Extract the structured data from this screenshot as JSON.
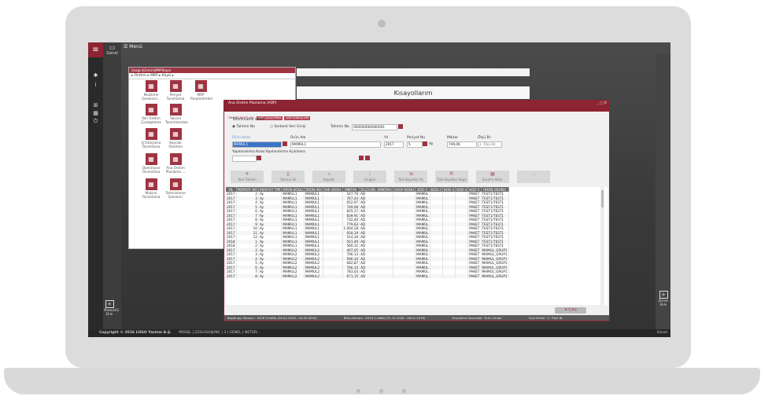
{
  "sidebar": {
    "genel": "Genel",
    "menu": "Menü",
    "masaustu": "Masaüstü Ekle",
    "icons": [
      "home-icon",
      "info-icon",
      "plus-square-icon",
      "apps-icon",
      "power-icon"
    ]
  },
  "shortcuts": {
    "title": "Kısayollarım"
  },
  "rightpanel": {
    "ekle": "Ekranı Ekle"
  },
  "menuwin": {
    "title": "Gezgin|Üretim|MRP\\Kayıt",
    "crumbs": "▸ Üretim  ▸  MRP  ▸  Kayıt  ▸",
    "items": [
      {
        "label": "Malzeme Gereksini...",
        "icon": "tools-icon"
      },
      {
        "label": "Periyot Tanımlama",
        "icon": "calculator-icon"
      },
      {
        "label": "MRP Parametreleri",
        "icon": "doc-gear-icon"
      },
      {
        "label": "İleri Üretim Çizelgeleme",
        "icon": "tools2-icon"
      },
      {
        "label": "Takvim Tanımlamaları",
        "icon": "calendar-icon"
      },
      {
        "label": "İş İstasyonu Tanımlama",
        "icon": "station-icon"
      },
      {
        "label": "Kaynak Yönetimi",
        "icon": "resource-icon"
      },
      {
        "label": "Operasyon Tanımlama",
        "icon": "operation-icon"
      },
      {
        "label": "Ana Üretim Planlama ...",
        "icon": "chart-icon"
      },
      {
        "label": "Makine Tanımlama",
        "icon": "machine-icon"
      },
      {
        "label": "Tahminleme İşlemleri",
        "icon": "trend-icon"
      }
    ]
  },
  "planwin": {
    "title": "Ana Üretim Planlama (AÜP)",
    "controls": "_ □ X",
    "tabs": [
      "TAHMİN KAYITLARI",
      "AÜP ÇALIŞTIRMA",
      "AÜP SONUÇLARI"
    ],
    "tahmin_verisi": "Tahminlama Verisi",
    "radio1": "Tahmin No",
    "radio2": "Serbest Veri Girişi",
    "tahmin_no_label": "Tahmin No",
    "tahmin_no": "000000000000001",
    "urun_kodu_label": "Ürün Kodu",
    "urun_kodu": "MAMUL1",
    "urun_adi_label": "Ürün Adı",
    "urun_adi": "MAMUL1",
    "yil_label": "Yıl",
    "yil": "2017",
    "periyot_label": "Periyot No",
    "periyot": "5",
    "periyot_unit": "Ay",
    "miktar_label": "Miktar",
    "miktar": "749,06",
    "olcu_label": "Ölçü Br.",
    "olcu": "2. Ölçü Br.",
    "yap_label": "Yapılandırma Kodu",
    "yap_aciklama": "Yapılandırma Açıklama",
    "toolbar": [
      "Yeni Tahmin",
      "Tahmin Sil",
      "Kaydet",
      "Gruplar",
      "Tüm Kayıtları Aç",
      "Tüm Kayıtları Kapa",
      "Excel'e Aktar",
      ""
    ],
    "exit": "Çıkış",
    "status": [
      "Başlangıç Zamanı : 2018 5.Hafta (26.02.2018 - 04.03.2018)",
      "Bitiş Zamanı : 2019 1.Hafta (31.12.2018 - 06.01.2019)",
      "Gruplama Seçeneği : Ürün Grubu",
      "Ölçü Birimi : 2. Ölçü Br."
    ]
  },
  "table": {
    "headers": [
      "YIL",
      "PERİYOT NO",
      "PERİYOT TİPİ",
      "ÜRÜN KODU",
      "ÜRÜN ADI",
      "YAP. KODU",
      "MİKTAR",
      "ÖLÇÜ BR. (MİKTAR)",
      "GRUP KODU",
      "KOD-1",
      "KOD-2",
      "KOD-3",
      "KOD-4",
      "KOD-5",
      "ÜRÜN GRUBU"
    ],
    "rows": [
      [
        "2017",
        "2",
        "Ay",
        "MAMUL1",
        "MAMUL1",
        "",
        "547,76",
        "AD",
        "",
        "MAMUL",
        "",
        "",
        "",
        "PAKET",
        "TEST1/TEST1"
      ],
      [
        "2017",
        "3",
        "Ay",
        "MAMUL1",
        "MAMUL1",
        "",
        "767,43",
        "AD",
        "",
        "MAMUL",
        "",
        "",
        "",
        "PAKET",
        "TEST1/TEST1"
      ],
      [
        "2017",
        "4",
        "Ay",
        "MAMUL1",
        "MAMUL1",
        "",
        "652,97",
        "AD",
        "",
        "MAMUL",
        "",
        "",
        "",
        "PAKET",
        "TEST1/TEST1"
      ],
      [
        "2017",
        "5",
        "Ay",
        "MAMUL1",
        "MAMUL1",
        "",
        "749,06",
        "AD",
        "",
        "MAMUL",
        "",
        "",
        "",
        "PAKET",
        "TEST1/TEST1"
      ],
      [
        "2017",
        "6",
        "Ay",
        "MAMUL1",
        "MAMUL1",
        "",
        "825,17",
        "AD",
        "",
        "MAMUL",
        "",
        "",
        "",
        "PAKET",
        "TEST1/TEST1"
      ],
      [
        "2017",
        "7",
        "Ay",
        "MAMUL1",
        "MAMUL1",
        "",
        "839,91",
        "AD",
        "",
        "MAMUL",
        "",
        "",
        "",
        "PAKET",
        "TEST1/TEST1"
      ],
      [
        "2017",
        "8",
        "Ay",
        "MAMUL1",
        "MAMUL1",
        "",
        "732,40",
        "AD",
        "",
        "MAMUL",
        "",
        "",
        "",
        "PAKET",
        "TEST1/TEST1"
      ],
      [
        "2017",
        "9",
        "Ay",
        "MAMUL1",
        "MAMUL1",
        "",
        "779,63",
        "AD",
        "",
        "MAMUL",
        "",
        "",
        "",
        "PAKET",
        "TEST1/TEST1"
      ],
      [
        "2017",
        "10",
        "Ay",
        "MAMUL1",
        "MAMUL1",
        "",
        "1.004,28",
        "AD",
        "",
        "MAMUL",
        "",
        "",
        "",
        "PAKET",
        "TEST1/TEST1"
      ],
      [
        "2017",
        "11",
        "Ay",
        "MAMUL1",
        "MAMUL1",
        "",
        "918,19",
        "AD",
        "",
        "MAMUL",
        "",
        "",
        "",
        "PAKET",
        "TEST1/TEST1"
      ],
      [
        "2017",
        "12",
        "Ay",
        "MAMUL1",
        "MAMUL1",
        "",
        "514,30",
        "AD",
        "",
        "MAMUL",
        "",
        "",
        "",
        "PAKET",
        "TEST1/TEST1"
      ],
      [
        "2018",
        "1",
        "Ay",
        "MAMUL1",
        "MAMUL1",
        "",
        "501,49",
        "AD",
        "",
        "MAMUL",
        "",
        "",
        "",
        "PAKET",
        "TEST1/TEST1"
      ],
      [
        "2018",
        "2",
        "Ay",
        "MAMUL1",
        "MAMUL1",
        "",
        "560,31",
        "AD",
        "",
        "MAMUL",
        "",
        "",
        "",
        "PAKET",
        "TEST1/TEST1"
      ],
      [
        "2017",
        "2",
        "Ay",
        "MAMUL2",
        "MAMUL2",
        "",
        "497,05",
        "AD",
        "",
        "MAMUL",
        "",
        "",
        "",
        "PAKET",
        "MAMUL_GRUP1"
      ],
      [
        "2017",
        "3",
        "Ay",
        "MAMUL2",
        "MAMUL2",
        "",
        "706,13",
        "AD",
        "",
        "MAMUL",
        "",
        "",
        "",
        "PAKET",
        "MAMUL_GRUP1"
      ],
      [
        "2017",
        "4",
        "Ay",
        "MAMUL2",
        "MAMUL2",
        "",
        "596,34",
        "AD",
        "",
        "MAMUL",
        "",
        "",
        "",
        "PAKET",
        "MAMUL_GRUP1"
      ],
      [
        "2017",
        "5",
        "Ay",
        "MAMUL2",
        "MAMUL2",
        "",
        "682,87",
        "AD",
        "",
        "MAMUL",
        "",
        "",
        "",
        "PAKET",
        "MAMUL_GRUP1"
      ],
      [
        "2017",
        "6",
        "Ay",
        "MAMUL2",
        "MAMUL2",
        "",
        "766,33",
        "AD",
        "",
        "MAMUL",
        "",
        "",
        "",
        "PAKET",
        "MAMUL_GRUP1"
      ],
      [
        "2017",
        "7",
        "Ay",
        "MAMUL2",
        "MAMUL2",
        "",
        "783,03",
        "AD",
        "",
        "MAMUL",
        "",
        "",
        "",
        "PAKET",
        "MAMUL_GRUP1"
      ],
      [
        "2017",
        "8",
        "Ay",
        "MAMUL2",
        "MAMUL2",
        "",
        "671,15",
        "AD",
        "",
        "MAMUL",
        "",
        "",
        "",
        "PAKET",
        "MAMUL_GRUP1"
      ]
    ]
  },
  "statusbar": {
    "copyright": "Copyright © 2016 LOGO Yazılım A.Ş.",
    "info": "MSSQL | 222LOGOJUNC | 3 | GENEL | NETSIS -",
    "right": "Genel"
  }
}
